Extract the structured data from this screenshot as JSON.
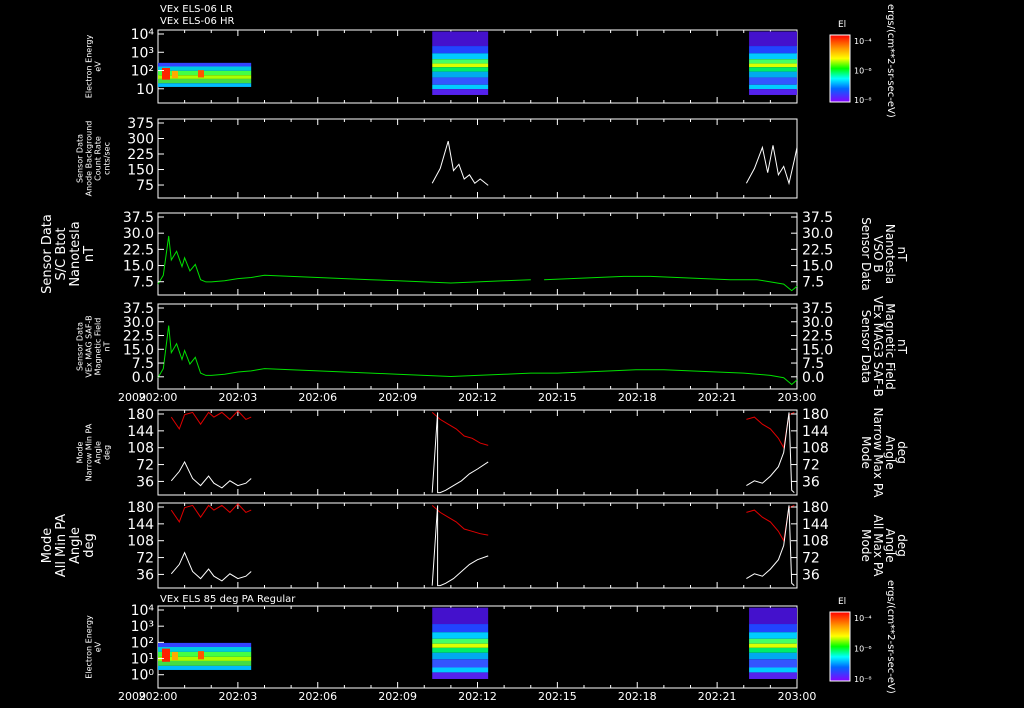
{
  "titles": [
    "VEx ELS-06 LR",
    "VEx ELS-06 HR"
  ],
  "bottom_title": "VEx ELS 85 deg PA Regular",
  "year": "2009",
  "colorbar": {
    "label": "El",
    "side_unit": "ergs/(cm**2-sr-sec-eV)",
    "ticks": [
      "10⁻⁴",
      "10⁻⁶",
      "10⁻⁸"
    ]
  },
  "colors": {
    "white": "#ffffff",
    "green": "#00e000",
    "red": "#e00000"
  },
  "chart_data": [
    {
      "type": "heatmap",
      "id": "spec_top",
      "ylabel": [
        "Electron Energy",
        "eV"
      ],
      "y_ticks": [
        "10⁴",
        "10³",
        "10²",
        "10"
      ],
      "x_ticks": [
        "202:00",
        "202:03",
        "202:06",
        "202:09",
        "202:12",
        "202:15",
        "202:18",
        "202:21",
        "203:00"
      ],
      "data_intervals": [
        [
          "202:00",
          "202:03.5"
        ],
        [
          "202:10.3",
          "202:12.4"
        ],
        [
          "202:22.2",
          "202:24"
        ]
      ]
    },
    {
      "type": "line",
      "id": "count_rate",
      "ylabel": [
        "Sensor Data",
        "Anode Background",
        "Count Rate",
        "cnts/sec"
      ],
      "y_ticks": [
        "375",
        "300",
        "225",
        "150",
        "75"
      ],
      "ylim": [
        0,
        375
      ],
      "series": [
        {
          "color": "white",
          "segments": [
            {
              "x": [
                10.3,
                10.6,
                10.9,
                11.1,
                11.3,
                11.5,
                11.7,
                11.9,
                12.1,
                12.4
              ],
              "y": [
                70,
                140,
                270,
                130,
                160,
                90,
                110,
                70,
                90,
                60
              ]
            },
            {
              "x": [
                22.1,
                22.4,
                22.7,
                22.9,
                23.1,
                23.3,
                23.5,
                23.7,
                23.9,
                24
              ],
              "y": [
                70,
                140,
                240,
                120,
                250,
                110,
                150,
                70,
                180,
                240
              ]
            }
          ]
        }
      ]
    },
    {
      "type": "line",
      "id": "btot",
      "ylabel": [
        "Sensor Data",
        "S/C Btot",
        "Nanotesla",
        "nT"
      ],
      "right_label": [
        "Sensor Data",
        "VSO B",
        "Nanotesla",
        "nT"
      ],
      "y_ticks": [
        "37.5",
        "30.0",
        "22.5",
        "15.0",
        "7.5"
      ],
      "ylim": [
        0,
        37.5
      ],
      "series": [
        {
          "color": "green",
          "segments": [
            {
              "x": [
                0,
                0.2,
                0.4,
                0.5,
                0.7,
                0.9,
                1.0,
                1.2,
                1.4,
                1.6,
                1.8,
                2.0,
                2.5,
                3.0,
                3.5,
                4.0,
                5.0,
                6.0,
                7.0,
                8.0,
                9.0,
                10.0,
                11.0,
                12.0,
                13.0,
                14.0
              ],
              "y": [
                5,
                9,
                27,
                16,
                20,
                13,
                17,
                11,
                14,
                7,
                6,
                6,
                6.5,
                7.5,
                8,
                9,
                8.5,
                8,
                7.5,
                7,
                6.5,
                6,
                5.5,
                6,
                6.5,
                7
              ]
            },
            {
              "x": [
                14.5,
                15.5,
                16.5,
                17.5,
                18.5,
                19.5,
                20.5,
                21.5,
                22.5,
                23.0,
                23.5,
                23.8,
                24
              ],
              "y": [
                7,
                7.5,
                8,
                8.5,
                8.5,
                8,
                7.5,
                7,
                7,
                6,
                5,
                2,
                4
              ]
            }
          ]
        }
      ]
    },
    {
      "type": "line",
      "id": "mag3",
      "ylabel": [
        "Sensor Data",
        "VEx MAG SAF-B",
        "Magnetic Field",
        "nT"
      ],
      "right_label": [
        "Sensor Data",
        "VEx MAG3 SAF-B",
        "Magnetic Field",
        "nT"
      ],
      "y_ticks": [
        "37.5",
        "30.0",
        "22.5",
        "15.0",
        "7.5",
        "0.0"
      ],
      "ylim": [
        0,
        37.5
      ],
      "series": [
        {
          "color": "green",
          "segments": [
            {
              "x": [
                0,
                0.2,
                0.4,
                0.5,
                0.7,
                0.9,
                1.0,
                1.2,
                1.4,
                1.6,
                1.8,
                2.0,
                2.5,
                3.0,
                3.5,
                4.0,
                5.0,
                6.0,
                7.0,
                8.0,
                9.0,
                10.0,
                11.0,
                12.0,
                13.0,
                14.0,
                15.0,
                16.0,
                17.0,
                18.0,
                19.0,
                20.0,
                21.0,
                22.0,
                23.0,
                23.5,
                23.8,
                24
              ],
              "y": [
                5,
                9,
                28,
                16,
                20,
                13,
                17,
                11,
                14,
                7,
                6,
                6,
                6.5,
                7.5,
                8,
                9,
                8.5,
                8,
                7.5,
                7,
                6.5,
                6,
                5.5,
                6,
                6.5,
                7,
                7,
                7.5,
                8,
                8.5,
                8.5,
                8,
                7.5,
                7,
                6,
                5,
                2,
                4
              ]
            }
          ]
        }
      ]
    },
    {
      "type": "line",
      "id": "narrow_pa",
      "ylabel": [
        "Mode",
        "Narrow Min PA",
        "Angle",
        "deg"
      ],
      "right_label": [
        "Mode",
        "Narrow Max PA",
        "Angle",
        "deg"
      ],
      "y_ticks": [
        "180",
        "144",
        "108",
        "72",
        "36"
      ],
      "ylim": [
        0,
        180
      ],
      "series": [
        {
          "color": "red",
          "segments": [
            {
              "x": [
                0.5,
                0.8,
                1.0,
                1.3,
                1.6,
                1.9,
                2.1,
                2.4,
                2.7,
                3.0,
                3.3,
                3.5
              ],
              "y": [
                165,
                140,
                170,
                175,
                150,
                175,
                165,
                175,
                160,
                178,
                160,
                165
              ]
            },
            {
              "x": [
                10.3,
                10.6,
                10.9,
                11.2,
                11.5,
                11.8,
                12.1,
                12.4
              ],
              "y": [
                175,
                160,
                150,
                140,
                125,
                120,
                110,
                105
              ]
            },
            {
              "x": [
                22.1,
                22.4,
                22.7,
                23.0,
                23.3,
                23.5,
                23.7,
                23.9
              ],
              "y": [
                160,
                165,
                150,
                140,
                120,
                100,
                170,
                175
              ]
            }
          ]
        },
        {
          "color": "white",
          "segments": [
            {
              "x": [
                0.5,
                0.8,
                1.0,
                1.3,
                1.6,
                1.9,
                2.1,
                2.4,
                2.7,
                3.0,
                3.3,
                3.5
              ],
              "y": [
                30,
                50,
                70,
                35,
                20,
                40,
                25,
                15,
                30,
                20,
                25,
                35
              ]
            },
            {
              "x": [
                10.3,
                10.5,
                10.5,
                10.6,
                10.8,
                11.1,
                11.4,
                11.7,
                12.0,
                12.4
              ],
              "y": [
                5,
                175,
                5,
                5,
                10,
                20,
                30,
                45,
                55,
                70
              ]
            },
            {
              "x": [
                22.1,
                22.4,
                22.7,
                23.0,
                23.3,
                23.5,
                23.7,
                23.8,
                23.9
              ],
              "y": [
                20,
                30,
                25,
                40,
                60,
                90,
                175,
                10,
                5
              ]
            }
          ]
        }
      ]
    },
    {
      "type": "line",
      "id": "all_pa",
      "ylabel": [
        "Mode",
        "All Min PA",
        "Angle",
        "deg"
      ],
      "right_label": [
        "Mode",
        "All Max PA",
        "Angle",
        "deg"
      ],
      "y_ticks": [
        "180",
        "144",
        "108",
        "72",
        "36"
      ],
      "ylim": [
        0,
        180
      ],
      "series": [
        {
          "color": "red",
          "segments": [
            {
              "x": [
                0.5,
                0.8,
                1.0,
                1.3,
                1.6,
                1.9,
                2.1,
                2.4,
                2.7,
                3.0,
                3.3,
                3.5
              ],
              "y": [
                165,
                140,
                170,
                175,
                150,
                175,
                165,
                175,
                160,
                178,
                160,
                165
              ]
            },
            {
              "x": [
                10.3,
                10.6,
                10.9,
                11.2,
                11.5,
                11.8,
                12.1,
                12.4
              ],
              "y": [
                175,
                160,
                150,
                140,
                125,
                120,
                115,
                112
              ]
            },
            {
              "x": [
                22.1,
                22.4,
                22.7,
                23.0,
                23.3,
                23.5,
                23.7,
                23.9
              ],
              "y": [
                160,
                165,
                150,
                140,
                120,
                100,
                170,
                175
              ]
            }
          ]
        },
        {
          "color": "white",
          "segments": [
            {
              "x": [
                0.5,
                0.8,
                1.0,
                1.3,
                1.6,
                1.9,
                2.1,
                2.4,
                2.7,
                3.0,
                3.3,
                3.5
              ],
              "y": [
                30,
                50,
                75,
                35,
                20,
                40,
                25,
                15,
                30,
                20,
                25,
                35
              ]
            },
            {
              "x": [
                10.3,
                10.5,
                10.5,
                10.6,
                10.8,
                11.1,
                11.4,
                11.7,
                12.0,
                12.4
              ],
              "y": [
                5,
                175,
                5,
                5,
                10,
                20,
                35,
                50,
                60,
                68
              ]
            },
            {
              "x": [
                22.1,
                22.4,
                22.7,
                23.0,
                23.3,
                23.5,
                23.7,
                23.8,
                23.9
              ],
              "y": [
                20,
                30,
                25,
                40,
                60,
                90,
                175,
                10,
                5
              ]
            }
          ]
        }
      ]
    },
    {
      "type": "heatmap",
      "id": "spec_bottom",
      "ylabel": [
        "Electron Energy",
        "eV"
      ],
      "y_ticks": [
        "10⁴",
        "10³",
        "10²",
        "10¹",
        "10⁰"
      ],
      "x_ticks": [
        "202:00",
        "202:03",
        "202:06",
        "202:09",
        "202:12",
        "202:15",
        "202:18",
        "202:21",
        "203:00"
      ],
      "data_intervals": [
        [
          "202:00",
          "202:03.5"
        ],
        [
          "202:10.3",
          "202:12.4"
        ],
        [
          "202:22.2",
          "202:24"
        ]
      ]
    }
  ]
}
